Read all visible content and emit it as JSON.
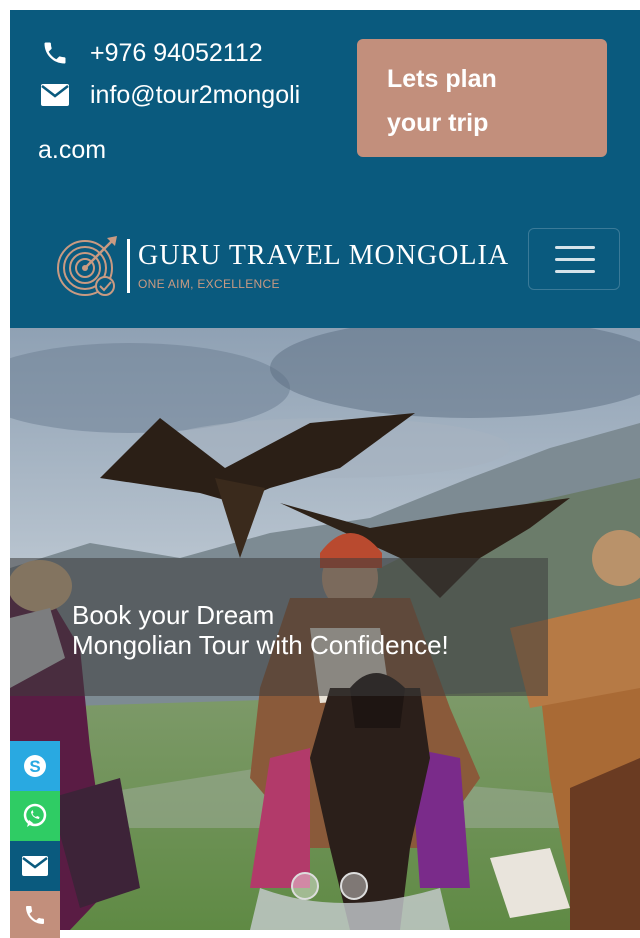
{
  "header": {
    "phone": "+976 94052112",
    "email_line1": "info@tour2mongoli",
    "email_line2": "a.com",
    "cta_line1": "Lets plan",
    "cta_line2": "your trip"
  },
  "logo": {
    "title": "GURU TRAVEL MONGOLIA",
    "tagline": "ONE AIM, EXCELLENCE"
  },
  "hero": {
    "caption_line1": "Book your Dream",
    "caption_line2": "Mongolian Tour with Confidence!"
  },
  "social": [
    {
      "icon": "skype-icon",
      "color": "#29a9e1"
    },
    {
      "icon": "whatsapp-icon",
      "color": "#2fcc64"
    },
    {
      "icon": "mail-icon",
      "color": "#0a5a7e"
    },
    {
      "icon": "phone-icon",
      "color": "#c28f7c"
    }
  ],
  "colors": {
    "header_bg": "#0a5a7e",
    "accent": "#c28f7c"
  }
}
